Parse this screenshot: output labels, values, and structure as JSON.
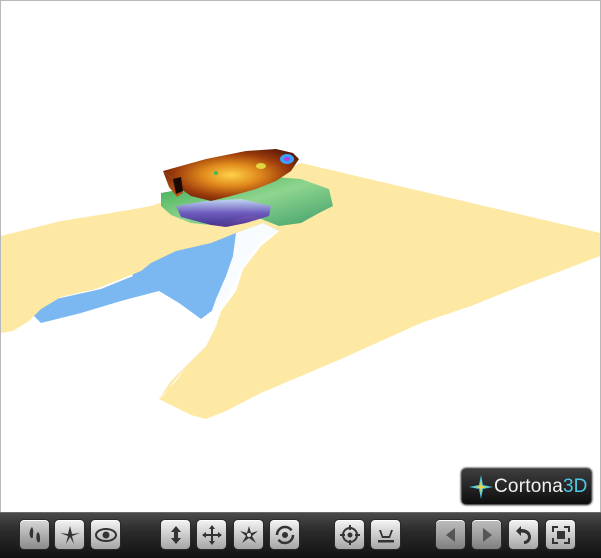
{
  "logo": {
    "brand": "Cortona",
    "accent": "3D"
  },
  "colors": {
    "terrain": "#fde9a3",
    "water": "#7bb8f2",
    "logo_accent": "#4cc9e8",
    "toolbar_bg": "#1e1e1e"
  },
  "toolbar": {
    "groups": [
      {
        "name": "navigation-mode",
        "icons": [
          "walk-icon",
          "fly-icon",
          "study-icon"
        ]
      },
      {
        "name": "movement",
        "icons": [
          "plan-icon",
          "pan-icon",
          "turn-icon",
          "roll-icon"
        ]
      },
      {
        "name": "view",
        "icons": [
          "goto-icon",
          "align-icon"
        ]
      },
      {
        "name": "viewpoints",
        "icons": [
          "previous-viewpoint-icon",
          "next-viewpoint-icon",
          "restore-icon",
          "fit-icon"
        ]
      }
    ]
  }
}
